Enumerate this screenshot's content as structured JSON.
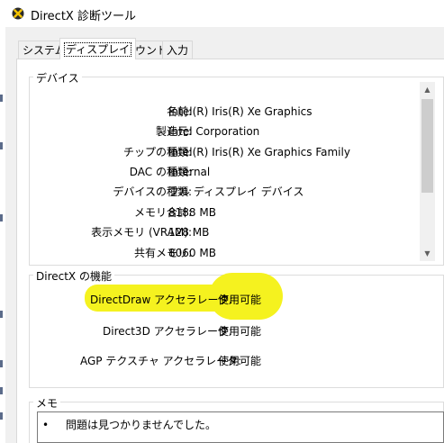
{
  "window": {
    "title": "DirectX 診断ツール",
    "icon": "directx-x-icon"
  },
  "tabs": [
    {
      "label": "システム",
      "active": false
    },
    {
      "label": "ディスプレイ",
      "active": true
    },
    {
      "label": "サウンド",
      "active": false
    },
    {
      "label": "入力",
      "active": false
    }
  ],
  "device": {
    "heading": "デバイス",
    "rows": [
      {
        "label": "名前:",
        "value": "Intel(R) Iris(R) Xe Graphics"
      },
      {
        "label": "製造元:",
        "value": "Intel Corporation"
      },
      {
        "label": "チップの種類:",
        "value": "Intel(R) Iris(R) Xe Graphics Family"
      },
      {
        "label": "DAC の種類:",
        "value": "Internal"
      },
      {
        "label": "デバイスの種類:",
        "value": "フル ディスプレイ デバイス"
      },
      {
        "label": "メモリ合計:",
        "value": "8188 MB"
      },
      {
        "label": "表示メモリ (VRAM):",
        "value": "128 MB"
      },
      {
        "label": "共有メモリ:",
        "value": "8060 MB"
      }
    ]
  },
  "features": {
    "heading": "DirectX の機能",
    "rows": [
      {
        "label": "DirectDraw アクセラレータ:",
        "value": "使用可能",
        "highlighted": true
      },
      {
        "label": "Direct3D アクセラレータ:",
        "value": "使用可能",
        "highlighted": false
      },
      {
        "label": "AGP テクスチャ アクセラレータ:",
        "value": "使用可能",
        "highlighted": false
      }
    ]
  },
  "notes": {
    "heading": "メモ",
    "items": [
      "問題は見つかりませんでした。"
    ]
  },
  "colors": {
    "highlight": "#f5f21f",
    "dialog_bg": "#f0f0f0"
  }
}
